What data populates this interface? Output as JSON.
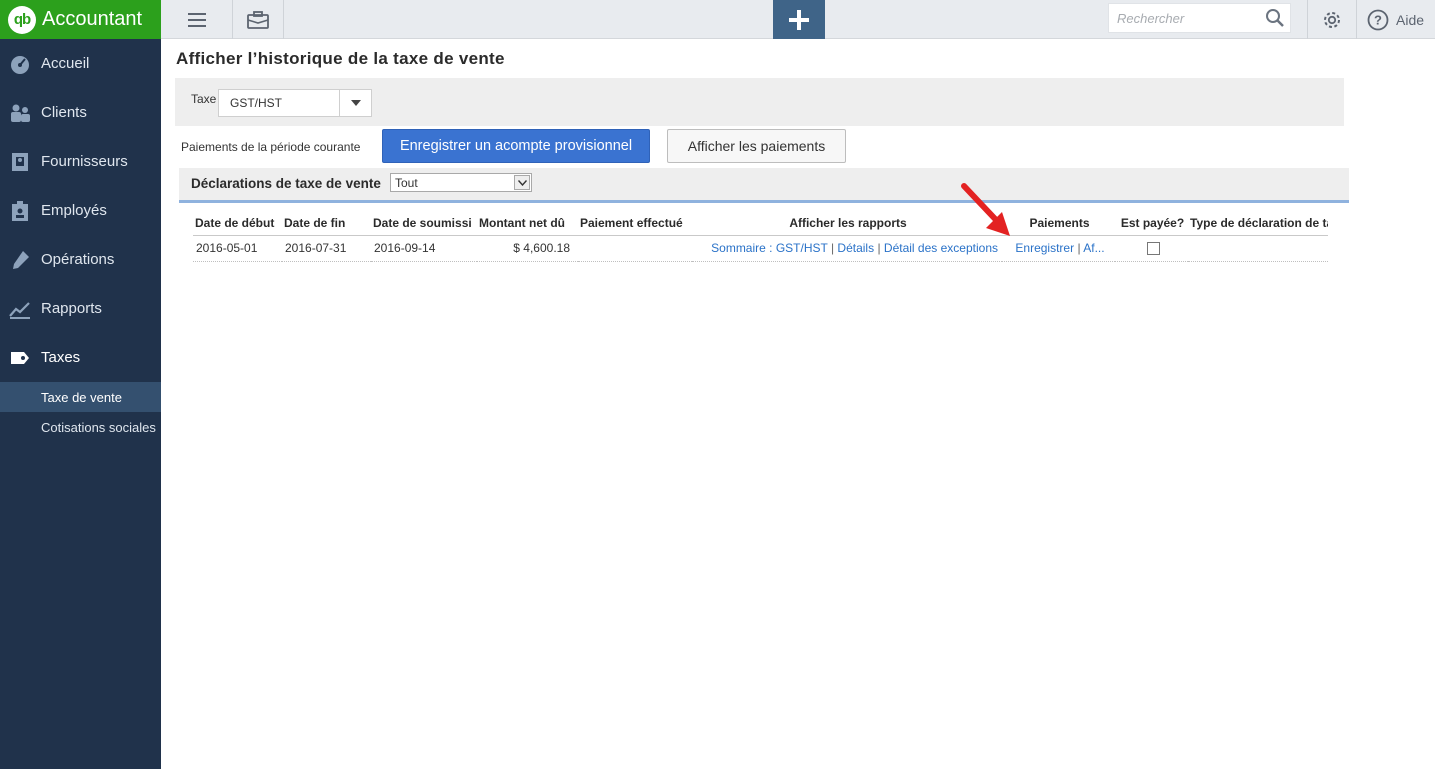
{
  "app": {
    "title": "Accountant",
    "logo_mark": "qb"
  },
  "sidebar": {
    "items": [
      {
        "label": "Accueil",
        "icon": "dashboard-icon"
      },
      {
        "label": "Clients",
        "icon": "customers-icon"
      },
      {
        "label": "Fournisseurs",
        "icon": "vendors-icon"
      },
      {
        "label": "Employés",
        "icon": "employees-icon"
      },
      {
        "label": "Opérations",
        "icon": "transactions-icon"
      },
      {
        "label": "Rapports",
        "icon": "reports-icon"
      },
      {
        "label": "Taxes",
        "icon": "taxes-icon"
      }
    ],
    "subitems": [
      {
        "label": "Taxe de vente",
        "selected": true
      },
      {
        "label": "Cotisations sociales",
        "selected": false
      }
    ]
  },
  "topbar": {
    "search_placeholder": "Rechercher",
    "help_label": "Aide",
    "accent": "#3f6488"
  },
  "page": {
    "title": "Afficher l’historique de la taxe de vente",
    "tax_label": "Taxe",
    "tax_value": "GST/HST",
    "payments_label": "Paiements de la période courante",
    "btn_record": "Enregistrer un acompte provisionnel",
    "btn_view": "Afficher les paiements",
    "declarations_title": "Déclarations de taxe de vente",
    "declarations_filter": "Tout"
  },
  "table": {
    "headers": {
      "start": "Date de début",
      "end": "Date de fin",
      "submit": "Date de soumissi",
      "net": "Montant net dû",
      "paid": "Paiement effectué",
      "reports": "Afficher les rapports",
      "payments": "Paiements",
      "is_paid": "Est payée?",
      "type": "Type de déclaration de tax"
    },
    "rows": [
      {
        "start": "2016-05-01",
        "end": "2016-07-31",
        "submit": "2016-09-14",
        "net": "$ 4,600.18",
        "paid": "",
        "report_summary": "Sommaire : GST/HST",
        "report_details": "Détails",
        "report_exceptions": "Détail des exceptions",
        "pay_record": "Enregistrer",
        "pay_view": "Af...",
        "sep": "|",
        "is_paid": false,
        "type": ""
      }
    ]
  },
  "colors": {
    "sidebar_bg": "#20324b",
    "brand_green": "#2ca01c",
    "primary_button": "#3a73d1",
    "link": "#2a72c8",
    "annotation_arrow": "#e32222"
  }
}
